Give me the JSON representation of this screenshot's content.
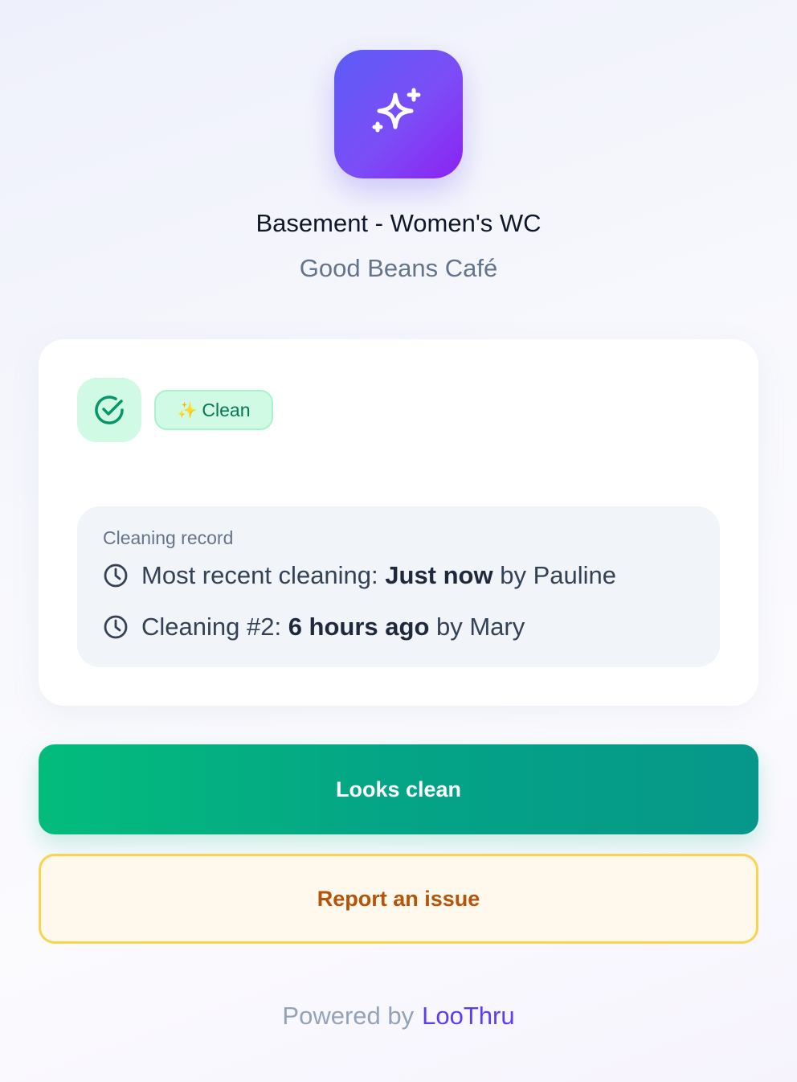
{
  "header": {
    "app_icon": "sparkles-icon",
    "location_title": "Basement - Women's WC",
    "business_name": "Good Beans Café"
  },
  "status": {
    "icon": "check-circle-icon",
    "badge_emoji": "✨",
    "badge_label": "Clean",
    "colors": {
      "badge_bg": "#d1fae5",
      "badge_text": "#047857"
    }
  },
  "cleaning_record": {
    "heading": "Cleaning record",
    "entries": [
      {
        "icon": "clock-icon",
        "prefix": "Most recent cleaning: ",
        "time": "Just now",
        "suffix": " by Pauline"
      },
      {
        "icon": "clock-icon",
        "prefix": "Cleaning #2: ",
        "time": "6 hours ago",
        "suffix": " by Mary"
      }
    ]
  },
  "actions": {
    "looks_clean_label": "Looks clean",
    "report_issue_label": "Report an issue"
  },
  "footer": {
    "powered_by": "Powered by",
    "brand": "LooThru",
    "brand_color": "#5b3df5"
  }
}
